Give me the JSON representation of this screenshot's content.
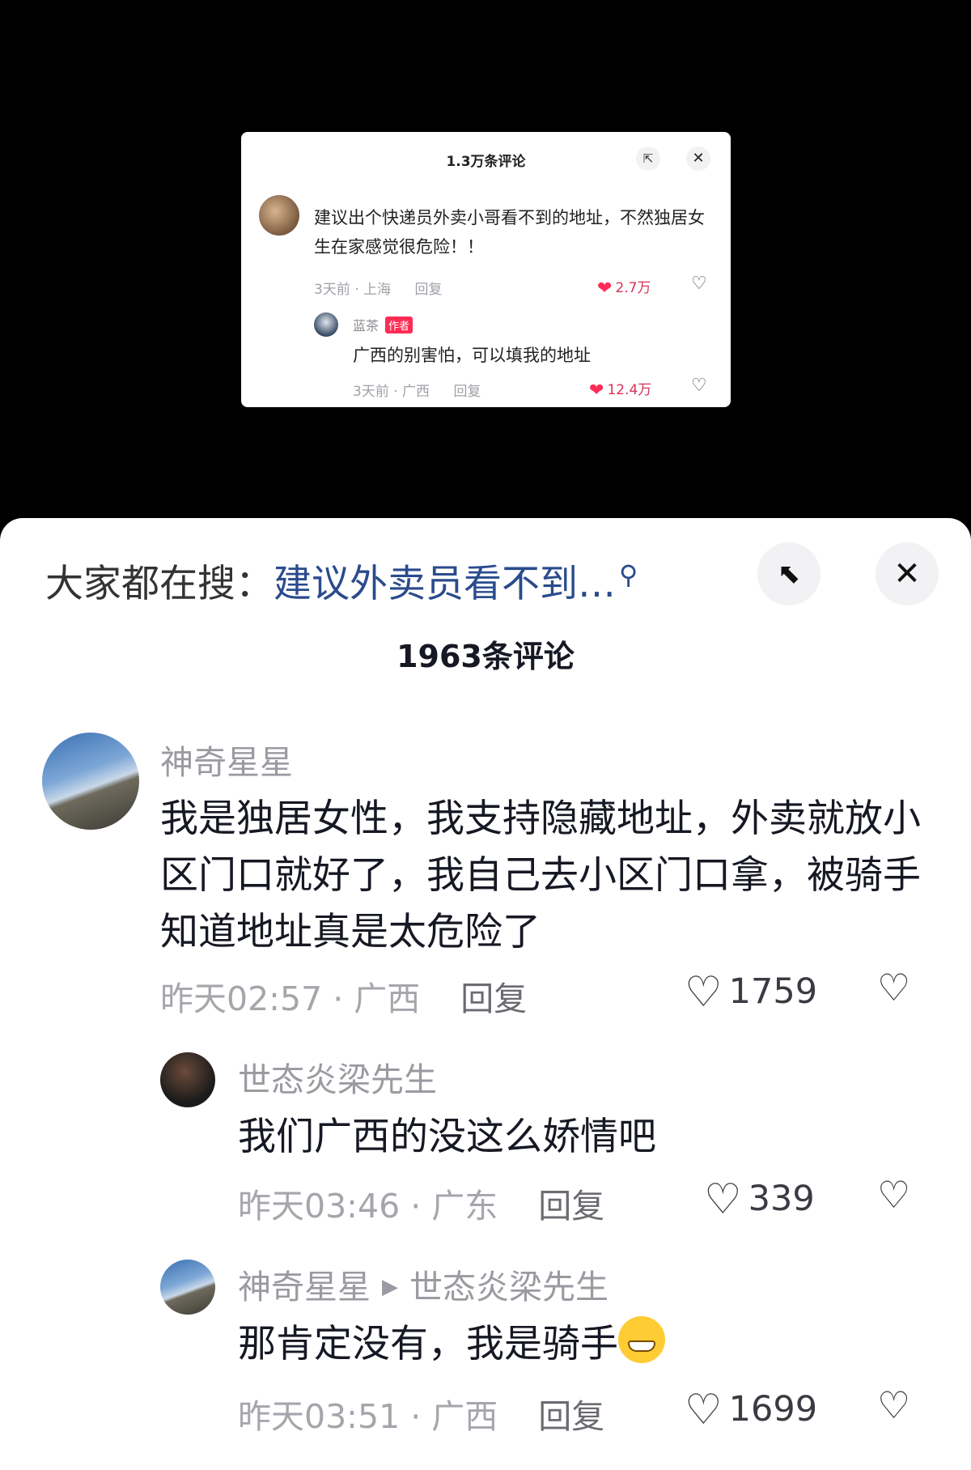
{
  "video_embed": {
    "title": "1.3万条评论",
    "shrink_icon": "shrink-icon",
    "close_icon": "close-icon",
    "comment": {
      "text": "建议出个快递员外卖小哥看不到的地址，不然独居女生在家感觉很危险！！",
      "time": "3天前 · 上海",
      "reply": "回复",
      "likes": "2.7万"
    },
    "reply": {
      "name": "蓝茶",
      "badge": "作者",
      "text": "广西的别害怕，可以填我的地址",
      "time": "3天前 · 广西",
      "reply": "回复",
      "likes": "12.4万"
    }
  },
  "sheet": {
    "search_label": "大家都在搜：",
    "search_term": "建议外卖员看不到…",
    "count_title": "1963条评论",
    "comments": [
      {
        "name": "神奇星星",
        "text": "我是独居女性，我支持隐藏地址，外卖就放小区门口就好了，我自己去小区门口拿，被骑手知道地址真是太危险了",
        "time": "昨天02:57 · 广西",
        "reply": "回复",
        "likes": "1759"
      },
      {
        "name": "世态炎梁先生",
        "text": "我们广西的没这么娇情吧",
        "time": "昨天03:46 · 广东",
        "reply": "回复",
        "likes": "339"
      },
      {
        "name": "神奇星星",
        "reply_to": "世态炎梁先生",
        "text": "那肯定没有，我是骑手",
        "time": "昨天03:51 · 广西",
        "reply": "回复",
        "likes": "1699"
      }
    ]
  },
  "colors": {
    "like_red": "#fe2c55",
    "search_blue": "#2a4b8d",
    "meta_gray": "#a5a6ac"
  }
}
